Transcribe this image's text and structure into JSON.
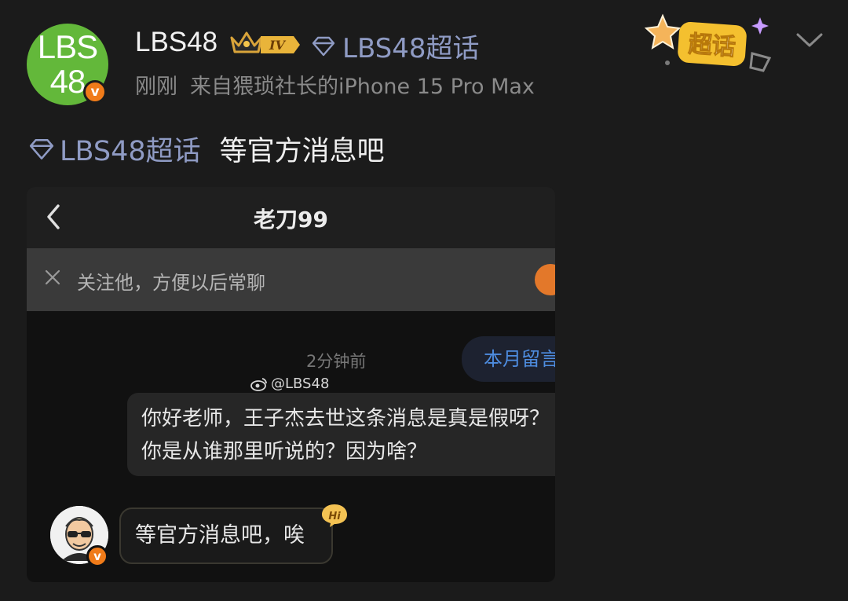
{
  "post": {
    "username": "LBS48",
    "avatar_text": "LBS48",
    "verified_badge": "v",
    "level_badge": "IV",
    "header_topic": "LBS48超话",
    "meta": {
      "time": "刚刚",
      "source": "来自猥琐社长的iPhone 15 Pro Max"
    },
    "sticker_text": "超话",
    "body_topic": "LBS48超话",
    "body_text": "等官方消息吧"
  },
  "screenshot": {
    "chat_title": "老刀99",
    "follow_prompt": "关注他，方便以后常聊",
    "timestamp": "2分钟前",
    "month_tag": "本月留言",
    "watermark": "@LBS48",
    "outgoing_message": "你好老师，王子杰去世这条消息是真是假呀？你是从谁那里听说的？因为啥？",
    "incoming_message": "等官方消息吧，唉",
    "hi_badge": "Hi",
    "peer_badge": "v"
  },
  "colors": {
    "background": "#1b1b1b",
    "topic_link": "#8f9bc4",
    "avatar_green": "#63b83a",
    "verified_orange": "#f07b19",
    "month_tag_blue": "#4e8de0"
  },
  "icons": [
    "crown-icon",
    "level-badge-icon",
    "diamond-icon",
    "chevron-down-icon",
    "back-arrow-icon",
    "close-icon",
    "weibo-icon",
    "hi-icon"
  ]
}
